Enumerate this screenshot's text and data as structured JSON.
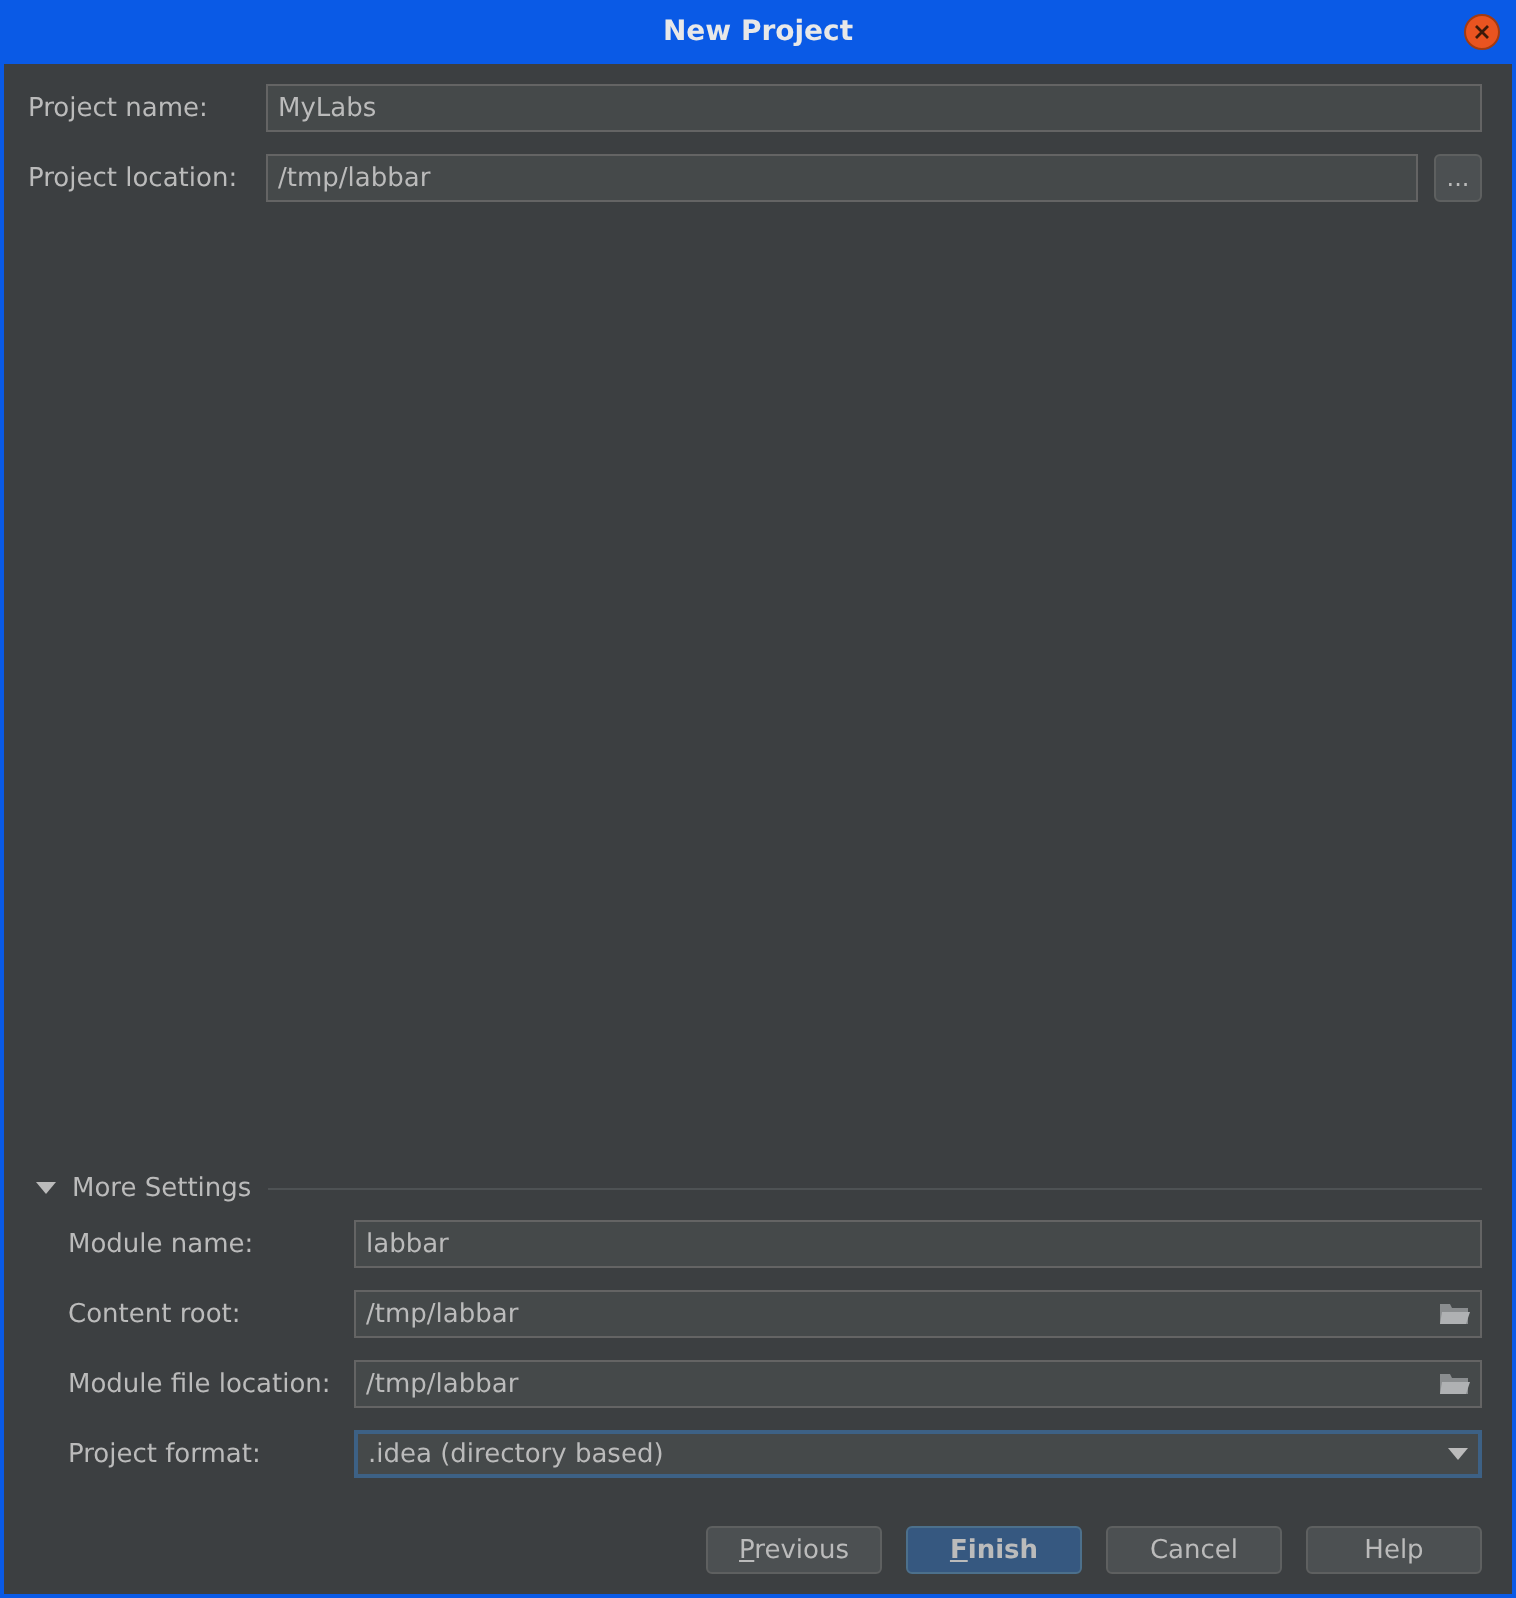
{
  "window": {
    "title": "New Project"
  },
  "project_fields": [
    {
      "label": "Project name:",
      "value": "MyLabs",
      "kind": "text"
    },
    {
      "label": "Project location:",
      "value": "/tmp/labbar",
      "kind": "browse",
      "button": "..."
    }
  ],
  "more_settings": {
    "title": "More Settings",
    "expanded": true,
    "fields": [
      {
        "label": "Module name:",
        "value": "labbar",
        "kind": "text",
        "focused": false
      },
      {
        "label": "Content root:",
        "value": "/tmp/labbar",
        "kind": "folder",
        "focused": false
      },
      {
        "label": "Module file location:",
        "value": "/tmp/labbar",
        "kind": "folder",
        "focused": false
      },
      {
        "label": "Project format:",
        "value": ".idea (directory based)",
        "kind": "dropdown",
        "focused": true
      }
    ]
  },
  "buttons": [
    {
      "label": "Previous",
      "default": false,
      "mnemonic_underlined": true
    },
    {
      "label": "Finish",
      "default": true,
      "mnemonic_underlined": true
    },
    {
      "label": "Cancel",
      "default": false,
      "mnemonic_underlined": false
    },
    {
      "label": "Help",
      "default": false,
      "mnemonic_underlined": false
    }
  ]
}
